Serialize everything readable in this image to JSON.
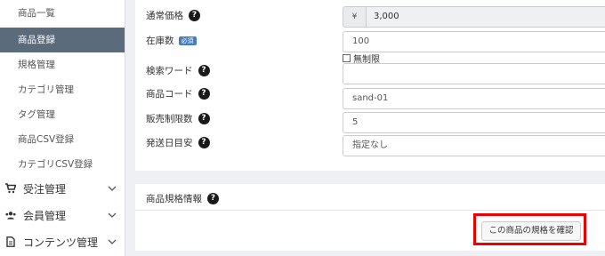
{
  "sidebar": {
    "sub_items": [
      {
        "label": "商品一覧",
        "active": false
      },
      {
        "label": "商品登録",
        "active": true
      },
      {
        "label": "規格管理",
        "active": false
      },
      {
        "label": "カテゴリ管理",
        "active": false
      },
      {
        "label": "タグ管理",
        "active": false
      },
      {
        "label": "商品CSV登録",
        "active": false
      },
      {
        "label": "カテゴリCSV登録",
        "active": false
      }
    ],
    "main_items": [
      {
        "label": "受注管理",
        "icon": "cart-icon"
      },
      {
        "label": "会員管理",
        "icon": "users-icon"
      },
      {
        "label": "コンテンツ管理",
        "icon": "document-icon"
      }
    ]
  },
  "form": {
    "price": {
      "label": "通常価格",
      "currency": "¥",
      "value": "3,000"
    },
    "stock": {
      "label": "在庫数",
      "badge": "必須",
      "value": "100",
      "unlimited_label": "無制限"
    },
    "search_word": {
      "label": "検索ワード",
      "value": ""
    },
    "product_code": {
      "label": "商品コード",
      "value": "sand-01"
    },
    "sale_limit": {
      "label": "販売制限数",
      "value": "5"
    },
    "delivery": {
      "label": "発送日目安",
      "value": "指定なし"
    }
  },
  "spec_section": {
    "title": "商品規格情報",
    "button_label": "この商品の規格を確認"
  },
  "colors": {
    "sidebar_active": "#5b6b7c",
    "badge": "#437ec4",
    "highlight": "#e00000"
  }
}
